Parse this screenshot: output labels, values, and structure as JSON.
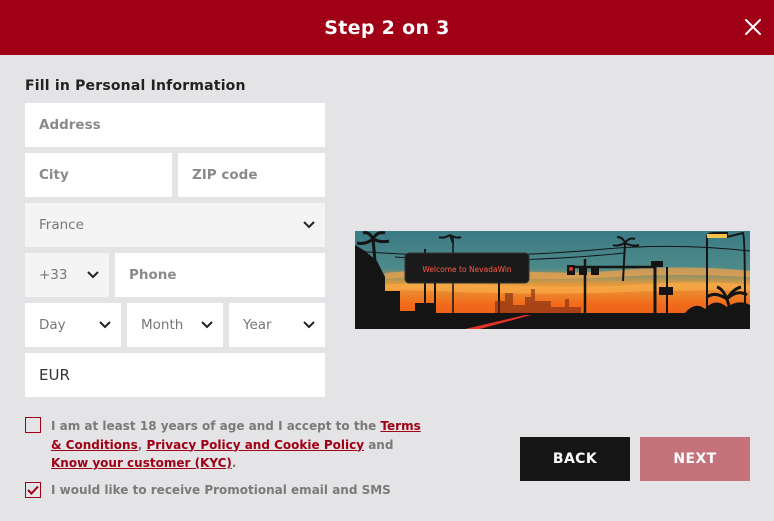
{
  "header": {
    "title": "Step 2 on 3"
  },
  "form": {
    "section_title": "Fill in Personal Information",
    "address_placeholder": "Address",
    "city_placeholder": "City",
    "zip_placeholder": "ZIP code",
    "country_value": "France",
    "phone_prefix": "+33",
    "phone_placeholder": "Phone",
    "day_label": "Day",
    "month_label": "Month",
    "year_label": "Year",
    "currency_value": "EUR"
  },
  "banner": {
    "sign_text": "Welcome to NevadaWin",
    "colors": {
      "sky_top": "#3a7a85",
      "sky_mid": "#f08a2e",
      "horizon": "#f26a1b",
      "silhouette": "#141414"
    }
  },
  "consent": {
    "age_text_1": "I am at least 18 years of age and I accept to the ",
    "terms_link": "Terms & Conditions",
    "comma": ", ",
    "privacy_link": "Privacy Policy and Cookie Policy",
    "and": " and ",
    "kyc_link": "Know your customer (KYC)",
    "period": ".",
    "age_checked": false,
    "promo_text": "I would like to receive Promotional email and SMS",
    "promo_checked": true
  },
  "buttons": {
    "back": "BACK",
    "next": "NEXT"
  },
  "colors": {
    "brand": "#a00015",
    "background": "#e4e3e5",
    "next_disabled": "#c6727b",
    "back": "#161616"
  },
  "icons": {
    "close": "close-icon",
    "chevron": "chevron-down-icon",
    "check": "checkmark-icon"
  }
}
